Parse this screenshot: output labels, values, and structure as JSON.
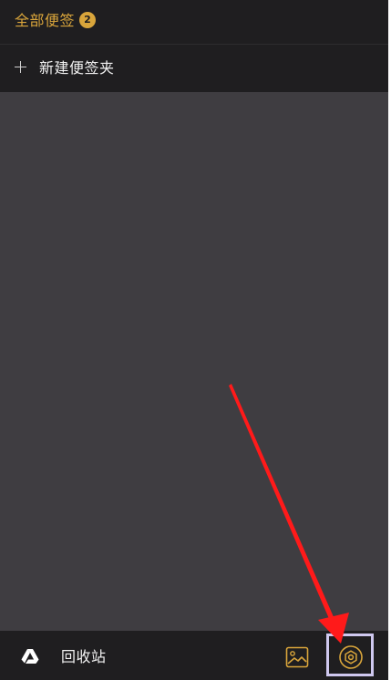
{
  "header": {
    "title": "全部便签",
    "badge_count": "2"
  },
  "new_folder": {
    "label": "新建便签夹",
    "icon": "plus-icon"
  },
  "bottom_bar": {
    "trash_label": "回收站",
    "trash_icon": "drive-triangle-icon",
    "image_icon": "image-icon",
    "settings_icon": "gear-icon"
  },
  "annotation": {
    "arrow_color": "#ff1a1a",
    "highlight_color": "#cfc8ef"
  },
  "colors": {
    "accent": "#d9a53b",
    "bar_background": "#1f1e20",
    "content_background": "#3f3d41"
  }
}
